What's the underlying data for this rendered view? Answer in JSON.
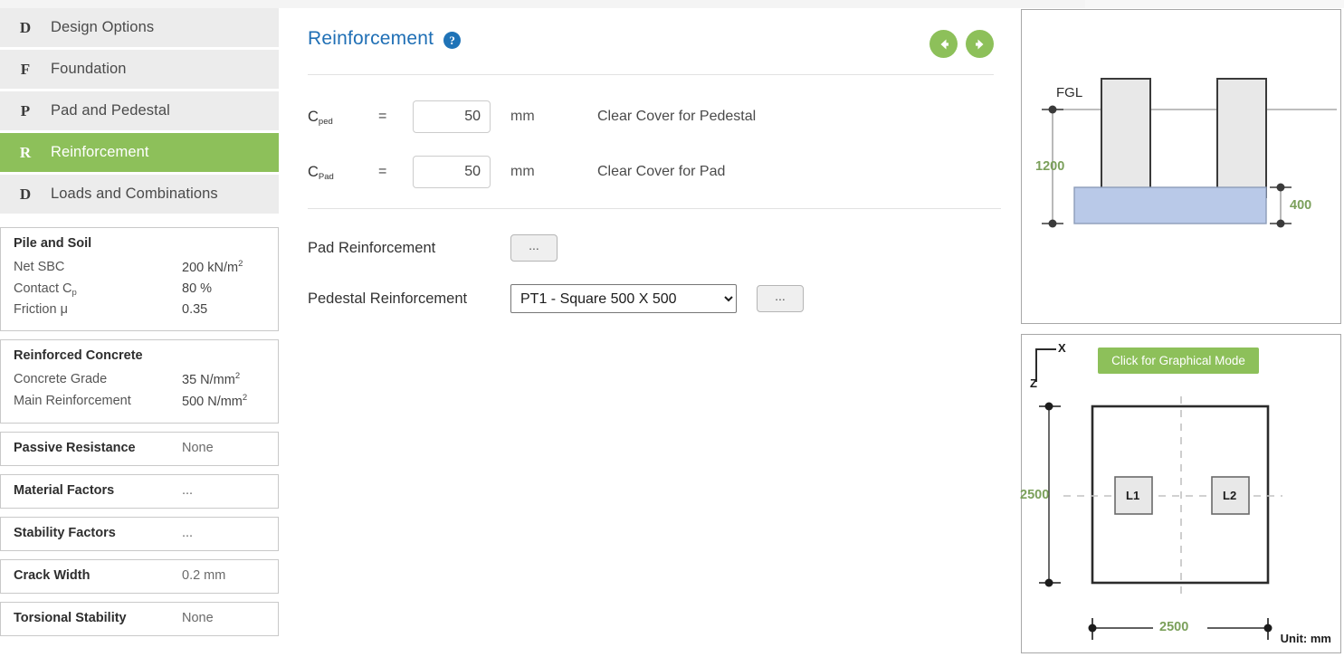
{
  "sidebar": {
    "nav_items": [
      {
        "letter": "D",
        "label": "Design Options",
        "active": false
      },
      {
        "letter": "F",
        "label": "Foundation",
        "active": false
      },
      {
        "letter": "P",
        "label": "Pad and Pedestal",
        "active": false
      },
      {
        "letter": "R",
        "label": "Reinforcement",
        "active": true
      },
      {
        "letter": "D",
        "label": "Loads and Combinations",
        "active": false
      }
    ],
    "cards": [
      {
        "title": "Pile and Soil",
        "rows": [
          {
            "key": "Net SBC",
            "value": "200 kN/m",
            "sup": "2"
          },
          {
            "key": "Contact C",
            "key_sub": "p",
            "value": "80 %"
          },
          {
            "key": "Friction μ",
            "value": "0.35"
          }
        ]
      },
      {
        "title": "Reinforced Concrete",
        "rows": [
          {
            "key": "Concrete Grade",
            "value": "35 N/mm",
            "sup": "2"
          },
          {
            "key": "Main Reinforcement",
            "value": "500 N/mm",
            "sup": "2"
          }
        ]
      }
    ],
    "inline_cards": [
      {
        "key": "Passive Resistance",
        "value": "None"
      },
      {
        "key": "Material Factors",
        "value": "..."
      },
      {
        "key": "Stability Factors",
        "value": "..."
      },
      {
        "key": "Crack Width",
        "value": "0.2 mm"
      },
      {
        "key": "Torsional Stability",
        "value": "None"
      }
    ]
  },
  "main": {
    "title": "Reinforcement",
    "help_icon": "question-mark-icon",
    "back_arrow": "arrow-left-circle-icon",
    "forward_arrow": "arrow-right-circle-icon",
    "fields": [
      {
        "symbol": "C",
        "symbol_sub": "ped",
        "equals": "=",
        "value": "50",
        "placeholder": "",
        "unit": "mm",
        "description": "Clear Cover for Pedestal"
      },
      {
        "symbol": "C",
        "symbol_sub": "Pad",
        "equals": "=",
        "value": "50",
        "placeholder": "",
        "unit": "mm",
        "description": "Clear Cover for Pad"
      }
    ],
    "pad_reinforcement": {
      "label": "Pad Reinforcement",
      "button_label": "..."
    },
    "pedestal_reinforcement": {
      "label": "Pedestal Reinforcement",
      "selected": "PT1 - Square 500 X 500",
      "options": [
        "PT1 - Square 500 X 500"
      ],
      "button_label": "..."
    }
  },
  "elevation": {
    "fgl_label": "FGL",
    "pedestal_height_dim": "1200",
    "pad_depth_dim": "400"
  },
  "plan": {
    "axis_x": "X",
    "axis_z": "Z",
    "graphical_mode_button": "Click for Graphical Mode",
    "pedestal_1": "L1",
    "pedestal_2": "L2",
    "height_dim": "2500",
    "width_dim": "2500",
    "unit_note": "Unit: mm"
  },
  "colors": {
    "accent_green": "#8dc05a",
    "title_blue": "#1f6fb5",
    "dim_green": "#7ba05b",
    "pad_blue": "#b9c9e8",
    "pedestal_gray": "#e8e8e8"
  }
}
